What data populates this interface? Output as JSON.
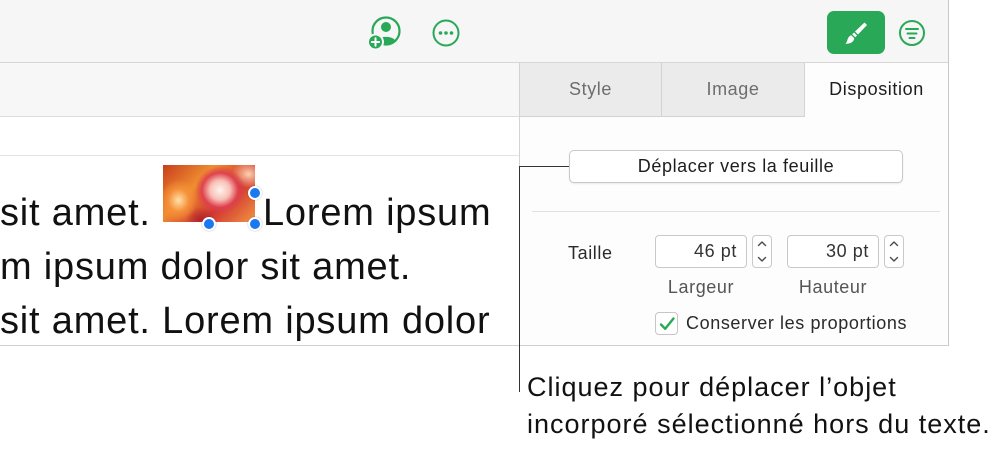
{
  "theme": {
    "accent": "#29a857",
    "selection": "#1b78f2"
  },
  "toolbar": {
    "icons": {
      "collaborate": "add-collaborator-icon",
      "more": "ellipsis-circle-icon",
      "format": "paintbrush-icon",
      "organize": "organize-icon"
    }
  },
  "document": {
    "line1_before": "sit amet.",
    "line1_after": "Lorem ipsum",
    "line2": "m ipsum dolor sit amet.",
    "line3": "sit amet. Lorem ipsum dolor"
  },
  "sidebar": {
    "tabs": [
      {
        "label": "Style",
        "selected": false
      },
      {
        "label": "Image",
        "selected": false
      },
      {
        "label": "Disposition",
        "selected": true
      }
    ],
    "move_to_sheet_button": "Déplacer vers la feuille",
    "size": {
      "label": "Taille",
      "width": {
        "value": "46 pt",
        "caption": "Largeur"
      },
      "height": {
        "value": "30 pt",
        "caption": "Hauteur"
      },
      "stepper_icons": [
        "chevron-up-icon",
        "chevron-down-icon"
      ]
    },
    "constrain_proportions": {
      "label": "Conserver les proportions",
      "checked": true,
      "icon": "checkmark-icon"
    }
  },
  "callout": {
    "lines": [
      "Cliquez pour déplacer l’objet",
      "incorporé sélectionné hors du texte."
    ]
  }
}
